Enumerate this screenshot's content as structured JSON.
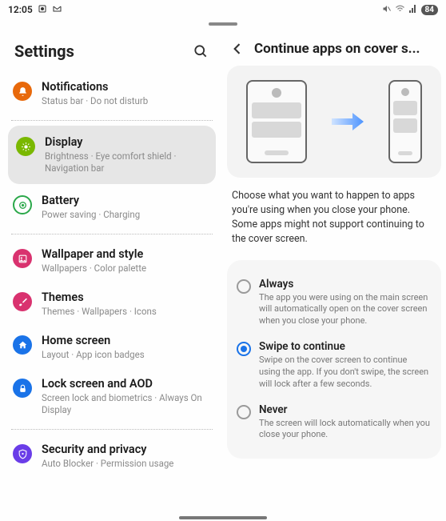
{
  "statusbar": {
    "time": "12:05",
    "battery": "84"
  },
  "left": {
    "title": "Settings",
    "items": [
      {
        "id": "notifications",
        "title": "Notifications",
        "sub": "Status bar · Do not disturb",
        "color": "#e8690b"
      },
      {
        "id": "display",
        "title": "Display",
        "sub": "Brightness · Eye comfort shield · Navigation bar",
        "color": "#7ab800"
      },
      {
        "id": "battery",
        "title": "Battery",
        "sub": "Power saving · Charging",
        "color": "#2ba84a"
      },
      {
        "id": "wallpaper",
        "title": "Wallpaper and style",
        "sub": "Wallpapers · Color palette",
        "color": "#d9326f"
      },
      {
        "id": "themes",
        "title": "Themes",
        "sub": "Themes · Wallpapers · Icons",
        "color": "#d9326f"
      },
      {
        "id": "home",
        "title": "Home screen",
        "sub": "Layout · App icon badges",
        "color": "#1a73e8"
      },
      {
        "id": "lock",
        "title": "Lock screen and AOD",
        "sub": "Screen lock and biometrics · Always On Display",
        "color": "#1a73e8"
      },
      {
        "id": "security",
        "title": "Security and privacy",
        "sub": "Auto Blocker · Permission usage",
        "color": "#6a3de8"
      }
    ]
  },
  "right": {
    "title": "Continue apps on cover s...",
    "description": "Choose what you want to happen to apps you're using when you close your phone. Some apps might not support continuing to the cover screen.",
    "options": [
      {
        "id": "always",
        "title": "Always",
        "sub": "The app you were using on the main screen will automatically open on the cover screen when you close your phone.",
        "checked": false
      },
      {
        "id": "swipe",
        "title": "Swipe to continue",
        "sub": "Swipe on the cover screen to continue using the app. If you don't swipe, the screen will lock after a few seconds.",
        "checked": true
      },
      {
        "id": "never",
        "title": "Never",
        "sub": "The screen will lock automatically when you close your phone.",
        "checked": false
      }
    ]
  }
}
